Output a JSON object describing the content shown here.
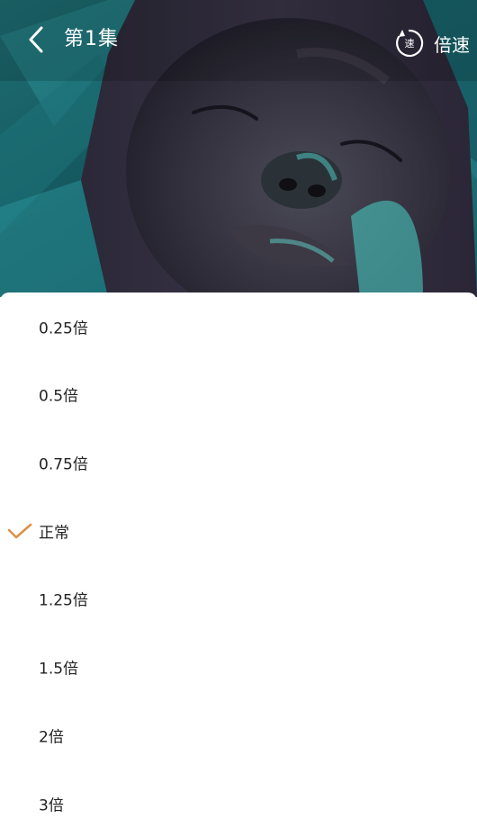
{
  "header": {
    "episode_title": "第1集",
    "speed_icon_char": "速",
    "speed_label": "倍速"
  },
  "speed_menu": {
    "options": [
      {
        "label": "0.25倍",
        "selected": false
      },
      {
        "label": "0.5倍",
        "selected": false
      },
      {
        "label": "0.75倍",
        "selected": false
      },
      {
        "label": "正常",
        "selected": true
      },
      {
        "label": "1.25倍",
        "selected": false
      },
      {
        "label": "1.5倍",
        "selected": false
      },
      {
        "label": "2倍",
        "selected": false
      },
      {
        "label": "3倍",
        "selected": false
      }
    ]
  },
  "colors": {
    "accent": "#d9924a",
    "text": "#222222",
    "overlay_text": "#ffffff"
  },
  "icons": {
    "back": "chevron-left-icon",
    "speed": "speed-icon",
    "selected": "check-icon"
  }
}
